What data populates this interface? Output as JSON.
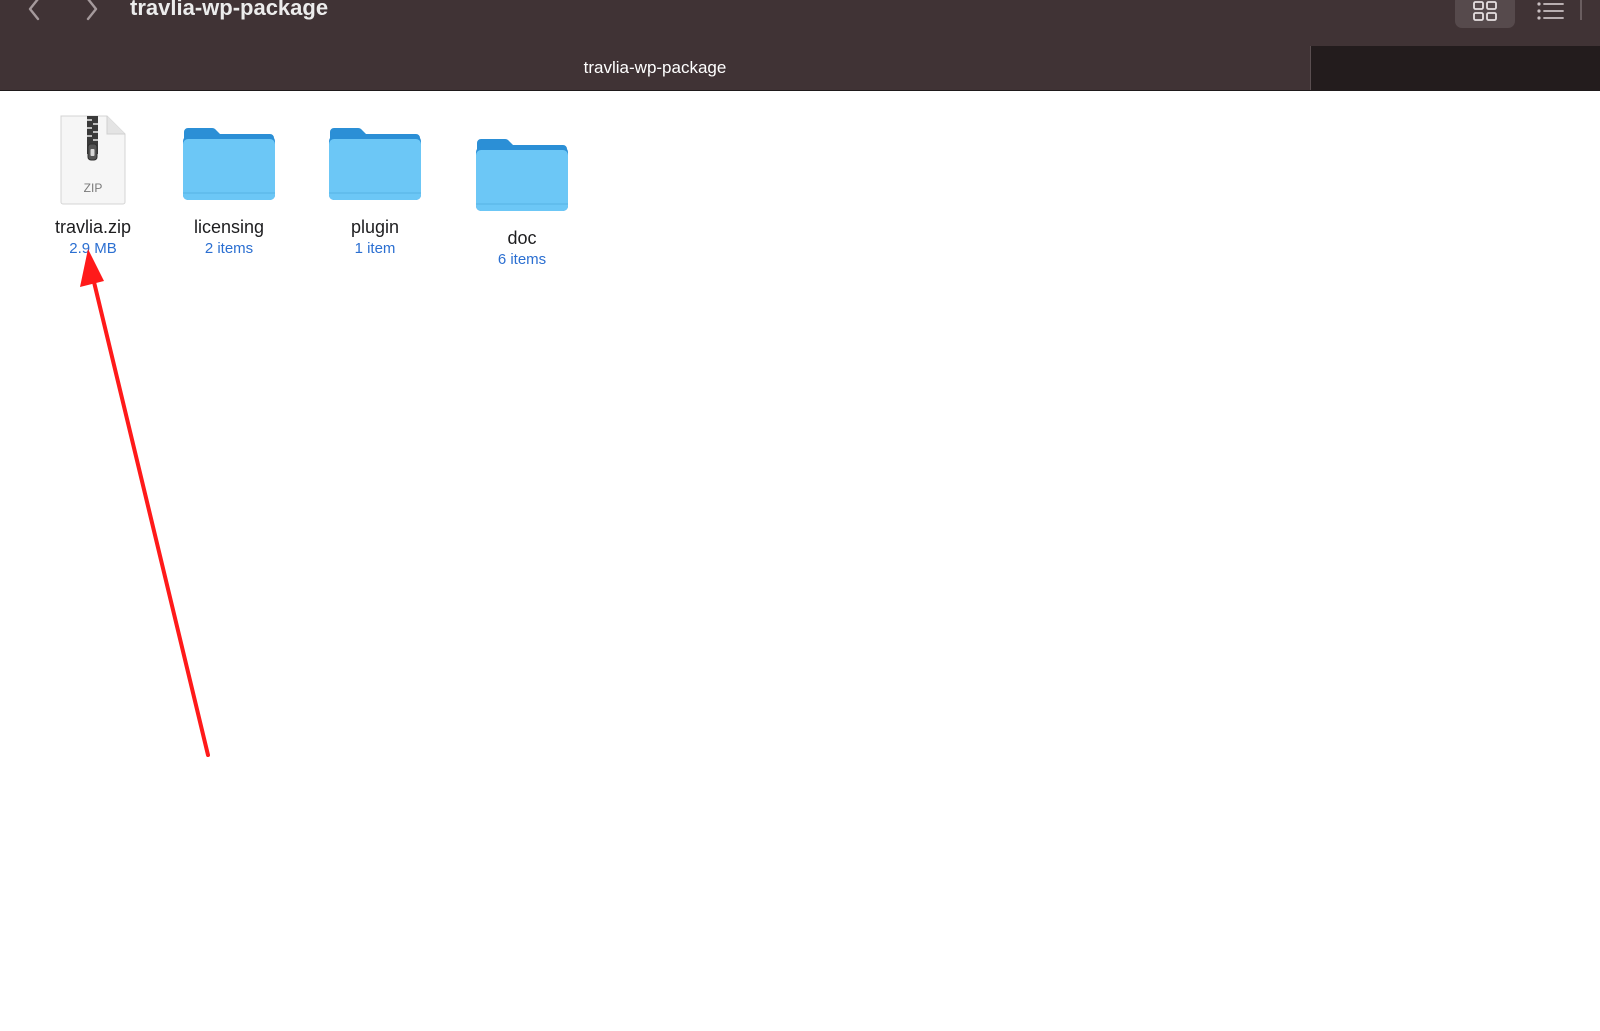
{
  "window": {
    "title": "travlia-wp-package"
  },
  "toolbar": {
    "back_icon": "chevron-left-icon",
    "forward_icon": "chevron-right-icon",
    "grid_view_icon": "grid-view-icon",
    "list_view_icon": "list-view-icon"
  },
  "tabs": [
    {
      "label": "travlia-wp-package",
      "active": true
    },
    {
      "label": "",
      "active": false
    }
  ],
  "files": [
    {
      "name": "travlia.zip",
      "meta": "2.9 MB",
      "kind": "zip-archive",
      "icon_label": "ZIP"
    },
    {
      "name": "licensing",
      "meta": "2 items",
      "kind": "folder"
    },
    {
      "name": "plugin",
      "meta": "1 item",
      "kind": "folder"
    },
    {
      "name": "doc",
      "meta": "6 items",
      "kind": "folder"
    }
  ],
  "colors": {
    "toolbar_bg": "#403335",
    "folder_front": "#6cc7f6",
    "folder_back": "#2b8fd6",
    "meta_text": "#2b6fd1",
    "annotation_arrow": "#ff1a1a"
  }
}
